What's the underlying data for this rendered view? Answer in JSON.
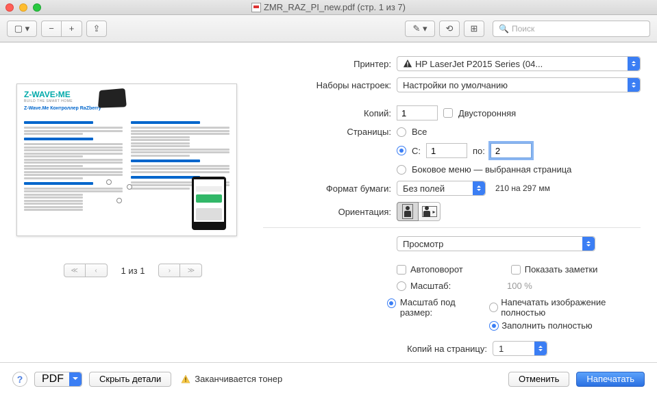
{
  "title": "ZMR_RAZ_PI_new.pdf (стр. 1 из 7)",
  "toolbar": {
    "search_placeholder": "Поиск"
  },
  "preview": {
    "logo": "Z-WAVE›ME",
    "logo_sub": "BUILD THE SMART HOME",
    "doc_title": "Z-Wave.Me Контроллер RaZberry",
    "page_label": "1 из 1"
  },
  "form": {
    "printer_label": "Принтер:",
    "printer_value": "HP LaserJet P2015 Series (04...",
    "presets_label": "Наборы настроек:",
    "presets_value": "Настройки по умолчанию",
    "copies_label": "Копий:",
    "copies_value": "1",
    "duplex_label": "Двусторонняя",
    "pages_label": "Страницы:",
    "pages_all": "Все",
    "pages_from": "С:",
    "pages_from_value": "1",
    "pages_to": "по:",
    "pages_to_value": "2",
    "pages_sidebar": "Боковое меню — выбранная страница",
    "paper_label": "Формат бумаги:",
    "paper_value": "Без полей",
    "paper_dims": "210 на 297 мм",
    "orientation_label": "Ориентация:",
    "app_select": "Просмотр",
    "autorotate": "Автоповорот",
    "show_notes": "Показать заметки",
    "scale_label": "Масштаб:",
    "scale_value": "100 %",
    "scale_fit_label": "Масштаб под размер:",
    "fit_full": "Напечатать изображение полностью",
    "fit_fill": "Заполнить полностью",
    "per_page_label": "Копий на страницу:",
    "per_page_value": "1"
  },
  "bottom": {
    "pdf": "PDF",
    "hide_details": "Скрыть детали",
    "toner_warning": "Заканчивается тонер",
    "cancel": "Отменить",
    "print": "Напечатать"
  }
}
